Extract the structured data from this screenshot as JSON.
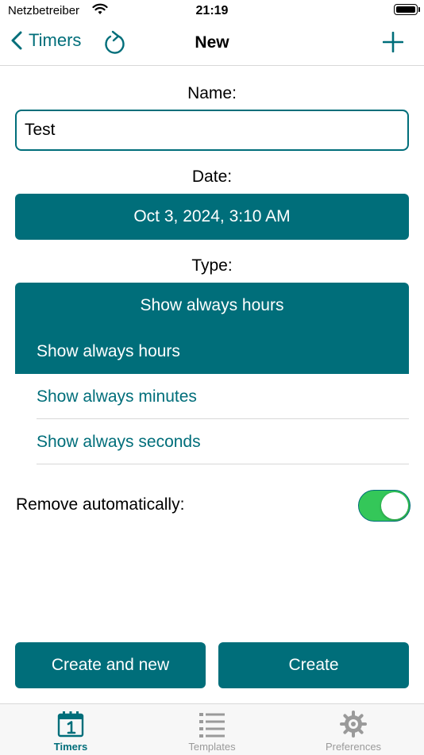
{
  "status_bar": {
    "carrier": "Netzbetreiber",
    "time": "21:19"
  },
  "nav": {
    "back_label": "Timers",
    "title": "New"
  },
  "form": {
    "name_label": "Name:",
    "name_value": "Test",
    "date_label": "Date:",
    "date_value": "Oct 3, 2024, 3:10 AM",
    "type_label": "Type:",
    "type_selected": "Show always hours",
    "type_options": [
      "Show always hours",
      "Show always minutes",
      "Show always seconds"
    ],
    "remove_label": "Remove automatically:",
    "remove_enabled": true
  },
  "actions": {
    "create_and_new": "Create and new",
    "create": "Create"
  },
  "tabs": [
    {
      "label": "Timers",
      "icon": "calendar-icon",
      "active": true
    },
    {
      "label": "Templates",
      "icon": "list-icon",
      "active": false
    },
    {
      "label": "Preferences",
      "icon": "gear-icon",
      "active": false
    }
  ],
  "colors": {
    "accent": "#006e7a",
    "toggle_on": "#34c759",
    "inactive": "#9a9a9a"
  }
}
